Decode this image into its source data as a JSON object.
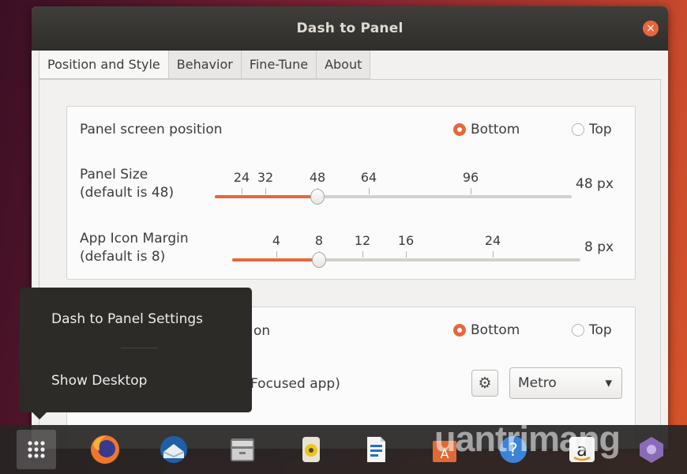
{
  "window": {
    "title": "Dash to Panel",
    "close_glyph": "×"
  },
  "tabs": [
    {
      "label": "Position and Style",
      "active": true
    },
    {
      "label": "Behavior"
    },
    {
      "label": "Fine-Tune"
    },
    {
      "label": "About"
    }
  ],
  "panel_position": {
    "label": "Panel screen position",
    "options": [
      {
        "label": "Bottom",
        "selected": true
      },
      {
        "label": "Top",
        "selected": false
      }
    ]
  },
  "panel_size": {
    "label_line1": "Panel Size",
    "label_line2": "(default is 48)",
    "marks": [
      "24",
      "32",
      "48",
      "64",
      "96"
    ],
    "value": 48,
    "value_text": "48 px"
  },
  "icon_margin": {
    "label_line1": "App Icon Margin",
    "label_line2": "(default is 8)",
    "marks": [
      "4",
      "8",
      "12",
      "16",
      "24"
    ],
    "value": 8,
    "value_text": "8 px"
  },
  "section2": {
    "label_partial": "on",
    "options": [
      {
        "label": "Bottom",
        "selected": true
      },
      {
        "label": "Top",
        "selected": false
      }
    ],
    "row2_label_partial": "Focused app)",
    "settings_icon": "gear-icon",
    "style_select": "Metro",
    "dropdown_glyph": "▾"
  },
  "context_menu": {
    "items": [
      {
        "label": "Dash to Panel Settings"
      },
      {
        "label": "Show Desktop"
      }
    ]
  },
  "dock": {
    "items": [
      "show-apps-icon",
      "firefox-icon",
      "thunderbird-icon",
      "files-icon",
      "rhythmbox-icon",
      "writer-icon",
      "software-icon",
      "help-icon",
      "amazon-icon",
      "extra-icon"
    ]
  },
  "watermark": "uantrimang"
}
